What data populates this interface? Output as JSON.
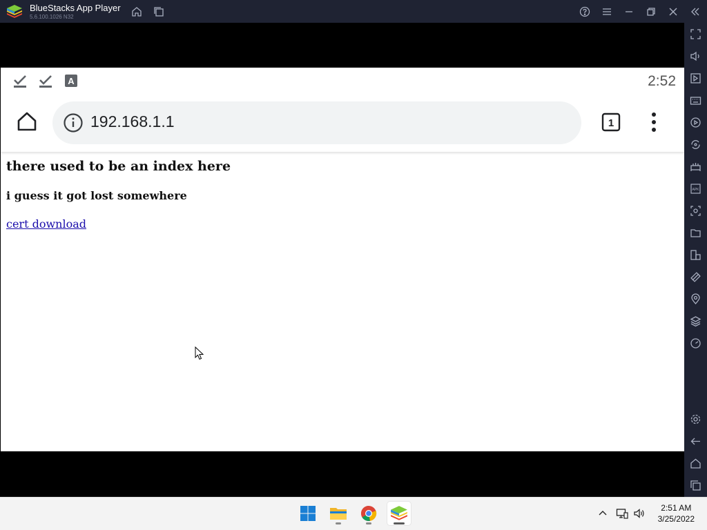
{
  "window": {
    "app_title": "BlueStacks App Player",
    "version": "5.6.100.1026 N32"
  },
  "android": {
    "clock": "2:52",
    "status_icons": [
      "download-done-icon",
      "download-done-icon",
      "a-letter-icon"
    ]
  },
  "browser": {
    "url": "192.168.1.1",
    "tab_count": "1"
  },
  "page": {
    "heading": "there used to be an index here",
    "subheading": "i guess it got lost somewhere",
    "link_text": "cert download"
  },
  "sidebar": {
    "icons": [
      "fullscreen-icon",
      "volume-icon",
      "media-manager-icon",
      "keyboard-icon",
      "macro-icon",
      "sync-icon",
      "gamepad-icon",
      "apk-icon",
      "screenshot-icon",
      "folder-icon",
      "multi-instance-icon",
      "rotate-icon",
      "location-icon",
      "layers-icon",
      "performance-icon",
      "settings-icon",
      "back-icon",
      "home-icon",
      "recents-icon"
    ]
  },
  "taskbar": {
    "time": "2:51 AM",
    "date": "3/25/2022",
    "apps": [
      "windows-start-icon",
      "file-explorer-icon",
      "chrome-icon",
      "bluestacks-icon"
    ]
  },
  "colors": {
    "chrome_bg": "#1f2333",
    "link": "#1a0dab",
    "omnibox": "#f1f3f4"
  }
}
